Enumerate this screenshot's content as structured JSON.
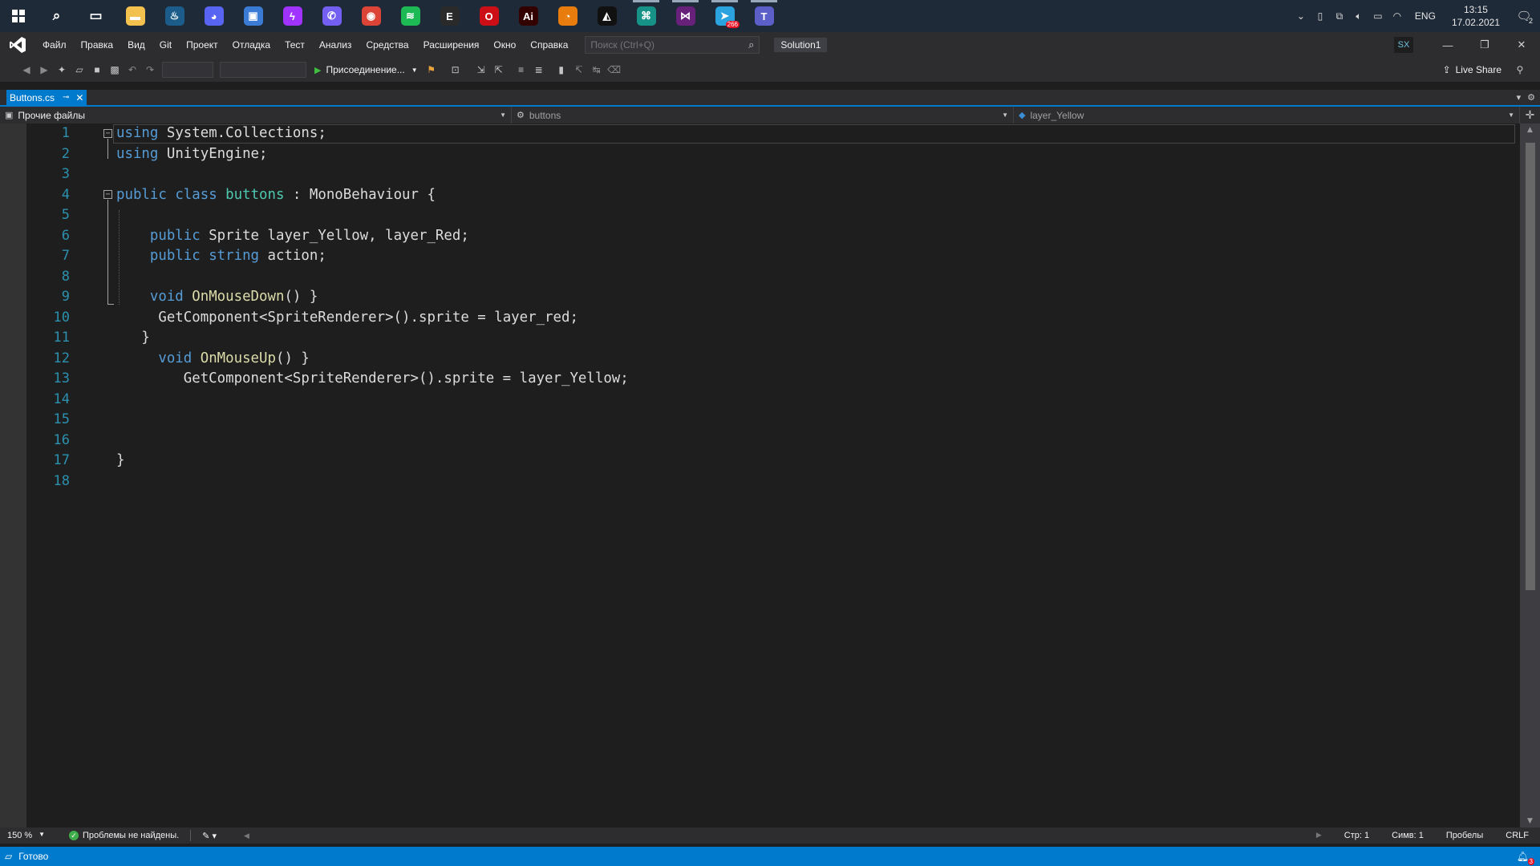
{
  "taskbar": {
    "apps": [
      {
        "name": "search-icon",
        "glyph": "⌕",
        "color": "transparent",
        "active": false
      },
      {
        "name": "task-view-icon",
        "glyph": "▭",
        "color": "transparent",
        "active": false
      },
      {
        "name": "file-explorer-icon",
        "glyph": "▬",
        "color": "#f2c14e",
        "active": false
      },
      {
        "name": "steam-icon",
        "glyph": "♨",
        "color": "#1b5c8a",
        "active": false
      },
      {
        "name": "discord-icon",
        "glyph": "◕",
        "color": "#5865f2",
        "active": false
      },
      {
        "name": "remote-desktop-icon",
        "glyph": "▣",
        "color": "#3a7bd5",
        "active": false
      },
      {
        "name": "messenger-icon",
        "glyph": "ϟ",
        "color": "#a033ff",
        "active": false
      },
      {
        "name": "viber-icon",
        "glyph": "✆",
        "color": "#7360f2",
        "active": false
      },
      {
        "name": "chrome-icon",
        "glyph": "◉",
        "color": "#db4437",
        "active": false
      },
      {
        "name": "spotify-icon",
        "glyph": "≋",
        "color": "#1db954",
        "active": false
      },
      {
        "name": "epic-games-icon",
        "glyph": "E",
        "color": "#2a2a2a",
        "active": false
      },
      {
        "name": "opera-icon",
        "glyph": "O",
        "color": "#cc0f16",
        "active": false
      },
      {
        "name": "illustrator-icon",
        "glyph": "Ai",
        "color": "#330000",
        "active": false
      },
      {
        "name": "blender-icon",
        "glyph": "◔",
        "color": "#e87d0d",
        "active": false
      },
      {
        "name": "unity-icon",
        "glyph": "◭",
        "color": "#111111",
        "active": false
      },
      {
        "name": "gitkraken-icon",
        "glyph": "⌘",
        "color": "#179287",
        "active": true
      },
      {
        "name": "visual-studio-icon",
        "glyph": "⋈",
        "color": "#68217a",
        "active": true
      },
      {
        "name": "telegram-icon",
        "glyph": "➤",
        "color": "#2aa3df",
        "active": true,
        "badge": "266"
      },
      {
        "name": "teams-icon",
        "glyph": "T",
        "color": "#5b5fc7",
        "active": true
      }
    ],
    "tray": {
      "lang": "ENG",
      "time": "13:15",
      "date": "17.02.2021",
      "notify_count": "2"
    }
  },
  "menubar": {
    "items": [
      "Файл",
      "Правка",
      "Вид",
      "Git",
      "Проект",
      "Отладка",
      "Тест",
      "Анализ",
      "Средства",
      "Расширения",
      "Окно",
      "Справка"
    ],
    "search_placeholder": "Поиск (Ctrl+Q)",
    "solution": "Solution1",
    "user_initials": "SX"
  },
  "toolbar": {
    "attach_label": "Присоединение...",
    "live_share": "Live Share"
  },
  "tabs": [
    {
      "label": "Buttons.cs"
    }
  ],
  "navbar": {
    "project": "Прочие файлы",
    "type": "buttons",
    "member": "layer_Yellow"
  },
  "editor": {
    "lines": [
      "using System.Collections;",
      "using UnityEngine;",
      "",
      "public class buttons : MonoBehaviour {",
      "",
      "    public Sprite layer_Yellow, layer_Red;",
      "    public string action;",
      "",
      "    void OnMouseDown() }",
      "     GetComponent<SpriteRenderer>().sprite = layer_red;",
      "   }",
      "     void OnMouseUp() }",
      "        GetComponent<SpriteRenderer>().sprite = layer_Yellow;",
      "",
      "",
      "",
      "}",
      ""
    ],
    "line_numbers": [
      "1",
      "2",
      "3",
      "4",
      "5",
      "6",
      "7",
      "8",
      "9",
      "10",
      "11",
      "12",
      "13",
      "14",
      "15",
      "16",
      "17",
      "18"
    ]
  },
  "editor_status": {
    "zoom": "150 %",
    "issues": "Проблемы не найдены.",
    "line": "Стр: 1",
    "col": "Симв: 1",
    "whitespace": "Пробелы",
    "eol": "CRLF"
  },
  "statusbar": {
    "text": "Готово",
    "notifications": "3"
  },
  "colors": {
    "accent": "#007acc",
    "keyword": "#569cd6",
    "type": "#4ec9b0",
    "method": "#dcdcaa",
    "line_number": "#2b91af"
  }
}
